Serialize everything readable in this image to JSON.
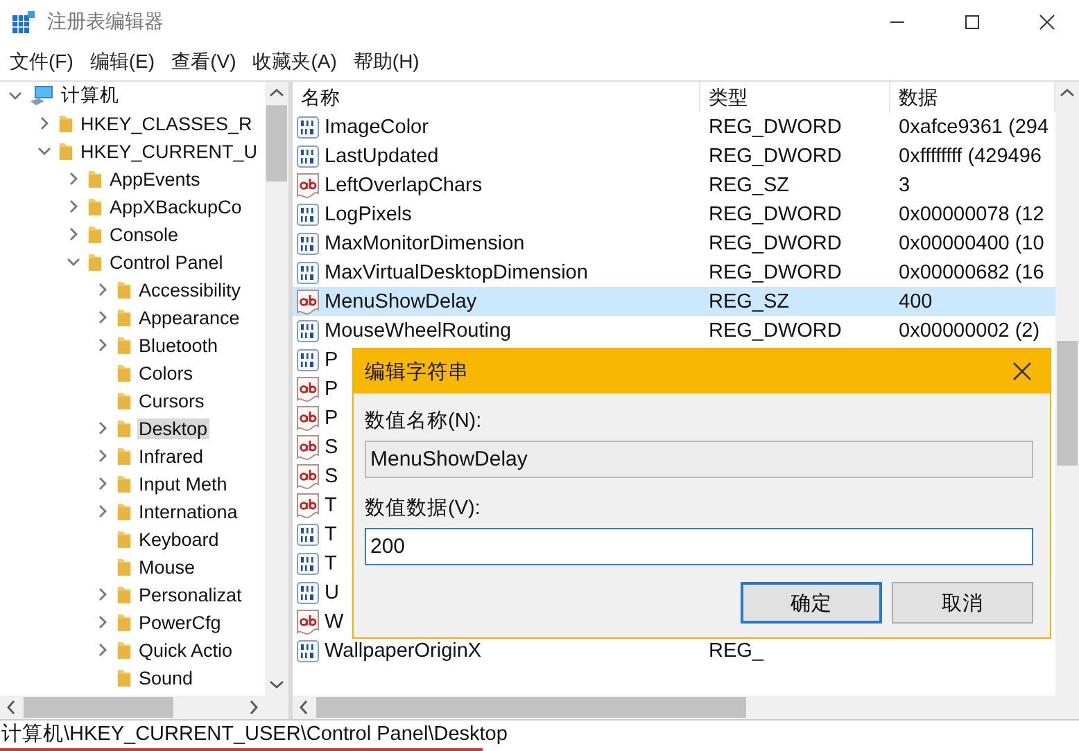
{
  "window": {
    "title": "注册表编辑器"
  },
  "menu": [
    "文件(F)",
    "编辑(E)",
    "查看(V)",
    "收藏夹(A)",
    "帮助(H)"
  ],
  "tree": [
    {
      "label": "计算机",
      "kind": "computer",
      "expandable": true,
      "expanded": true,
      "selected": false,
      "children": [
        {
          "label": "HKEY_CLASSES_R",
          "kind": "folder",
          "expandable": true,
          "expanded": false,
          "selected": false
        },
        {
          "label": "HKEY_CURRENT_U",
          "kind": "folder",
          "expandable": true,
          "expanded": true,
          "selected": false,
          "children": [
            {
              "label": "AppEvents",
              "kind": "folder",
              "expandable": true,
              "expanded": false,
              "selected": false
            },
            {
              "label": "AppXBackupCo",
              "kind": "folder",
              "expandable": true,
              "expanded": false,
              "selected": false
            },
            {
              "label": "Console",
              "kind": "folder",
              "expandable": true,
              "expanded": false,
              "selected": false
            },
            {
              "label": "Control Panel",
              "kind": "folder",
              "expandable": true,
              "expanded": true,
              "selected": false,
              "children": [
                {
                  "label": "Accessibility",
                  "kind": "folder",
                  "expandable": true,
                  "expanded": false,
                  "selected": false
                },
                {
                  "label": "Appearance",
                  "kind": "folder",
                  "expandable": true,
                  "expanded": false,
                  "selected": false
                },
                {
                  "label": "Bluetooth",
                  "kind": "folder",
                  "expandable": true,
                  "expanded": false,
                  "selected": false
                },
                {
                  "label": "Colors",
                  "kind": "folder",
                  "expandable": false,
                  "selected": false
                },
                {
                  "label": "Cursors",
                  "kind": "folder",
                  "expandable": false,
                  "selected": false
                },
                {
                  "label": "Desktop",
                  "kind": "folder",
                  "expandable": true,
                  "expanded": false,
                  "selected": true
                },
                {
                  "label": "Infrared",
                  "kind": "folder",
                  "expandable": true,
                  "expanded": false,
                  "selected": false
                },
                {
                  "label": "Input Meth",
                  "kind": "folder",
                  "expandable": true,
                  "expanded": false,
                  "selected": false
                },
                {
                  "label": "Internationa",
                  "kind": "folder",
                  "expandable": true,
                  "expanded": false,
                  "selected": false
                },
                {
                  "label": "Keyboard",
                  "kind": "folder",
                  "expandable": false,
                  "selected": false
                },
                {
                  "label": "Mouse",
                  "kind": "folder",
                  "expandable": false,
                  "selected": false
                },
                {
                  "label": "Personalizat",
                  "kind": "folder",
                  "expandable": true,
                  "expanded": false,
                  "selected": false
                },
                {
                  "label": "PowerCfg",
                  "kind": "folder",
                  "expandable": true,
                  "expanded": false,
                  "selected": false
                },
                {
                  "label": "Quick Actio",
                  "kind": "folder",
                  "expandable": true,
                  "expanded": false,
                  "selected": false
                },
                {
                  "label": "Sound",
                  "kind": "folder",
                  "expandable": false,
                  "selected": false
                }
              ]
            }
          ]
        }
      ]
    }
  ],
  "table": {
    "columns": [
      "名称",
      "类型",
      "数据"
    ],
    "rows": [
      {
        "kind": "dword",
        "name": "ImageColor",
        "type": "REG_DWORD",
        "data": "0xafce9361 (294",
        "selected": false
      },
      {
        "kind": "dword",
        "name": "LastUpdated",
        "type": "REG_DWORD",
        "data": "0xffffffff (429496",
        "selected": false
      },
      {
        "kind": "string",
        "name": "LeftOverlapChars",
        "type": "REG_SZ",
        "data": "3",
        "selected": false
      },
      {
        "kind": "dword",
        "name": "LogPixels",
        "type": "REG_DWORD",
        "data": "0x00000078 (12",
        "selected": false
      },
      {
        "kind": "dword",
        "name": "MaxMonitorDimension",
        "type": "REG_DWORD",
        "data": "0x00000400 (10",
        "selected": false
      },
      {
        "kind": "dword",
        "name": "MaxVirtualDesktopDimension",
        "type": "REG_DWORD",
        "data": "0x00000682 (16",
        "selected": false
      },
      {
        "kind": "string",
        "name": "MenuShowDelay",
        "type": "REG_SZ",
        "data": "400",
        "selected": true
      },
      {
        "kind": "dword",
        "name": "MouseWheelRouting",
        "type": "REG_DWORD",
        "data": "0x00000002 (2)",
        "selected": false
      },
      {
        "kind": "dword",
        "name": "P",
        "selected": false
      },
      {
        "kind": "string",
        "name": "P",
        "selected": false
      },
      {
        "kind": "string",
        "name": "P",
        "selected": false
      },
      {
        "kind": "string",
        "name": "S",
        "selected": false
      },
      {
        "kind": "string",
        "name": "S",
        "selected": false
      },
      {
        "kind": "string",
        "name": "T",
        "selected": false
      },
      {
        "kind": "dword",
        "name": "T",
        "selected": false
      },
      {
        "kind": "dword",
        "name": "T",
        "selected": false
      },
      {
        "kind": "dword",
        "name": "U",
        "selected": false
      },
      {
        "kind": "string",
        "name": "W",
        "selected": false
      },
      {
        "kind": "dword",
        "name": "WallpaperOriginX",
        "type": "REG_",
        "selected": false
      }
    ]
  },
  "dialog": {
    "title": "编辑字符串",
    "name_label": "数值名称(N):",
    "name_value": "MenuShowDelay",
    "data_label": "数值数据(V):",
    "data_value": "200",
    "buttons": [
      {
        "label": "确定",
        "default": true
      },
      {
        "label": "取消",
        "default": false
      }
    ]
  },
  "status_bar": "计算机\\HKEY_CURRENT_USER\\Control Panel\\Desktop"
}
